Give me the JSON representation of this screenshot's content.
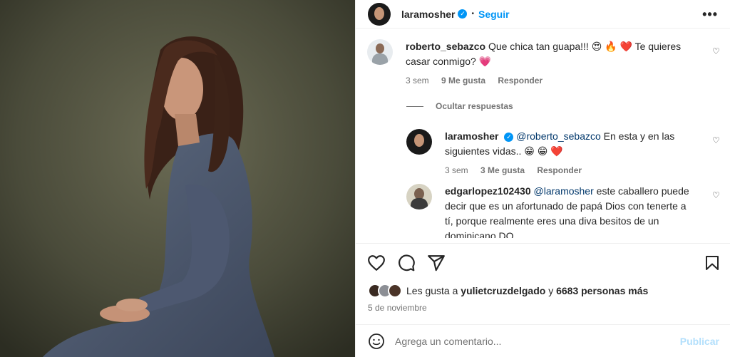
{
  "header": {
    "username": "laramosher",
    "separator": "•",
    "follow_label": "Seguir",
    "more_label": "•••"
  },
  "comments": [
    {
      "username": "roberto_sebazco",
      "text": "Que chica tan guapa!!! 😍 🔥 ❤️  Te quieres casar conmigo? 💗",
      "time": "3 sem",
      "likes": "9 Me gusta",
      "reply_label": "Responder"
    },
    {
      "username": "laramosher",
      "mention": "@roberto_sebazco",
      "text": "En esta y en las siguientes vidas.. 😁 😁 ❤️",
      "time": "3 sem",
      "likes": "3 Me gusta",
      "reply_label": "Responder"
    },
    {
      "username": "edgarlopez102430",
      "mention": "@laramosher",
      "text": "este caballero puede decir que es un afortunado de papá Dios con tenerte a tí, porque realmente eres una diva besitos de un dominicano DO"
    }
  ],
  "hide_replies_label": "Ocultar respuestas",
  "likes": {
    "prefix": "Les gusta a ",
    "user": "yulietcruzdelgado",
    "middle": " y ",
    "count": "6683 personas más"
  },
  "date": "5 de noviembre",
  "comment_input": {
    "placeholder": "Agrega un comentario...",
    "post_label": "Publicar"
  },
  "icons": [
    "heart-icon",
    "comment-icon",
    "share-icon",
    "bookmark-icon",
    "emoji-icon",
    "more-icon",
    "verified-icon"
  ],
  "colors": {
    "link": "#0095f6",
    "text": "#262626",
    "muted": "#737373",
    "like_red": "#ed4956"
  }
}
